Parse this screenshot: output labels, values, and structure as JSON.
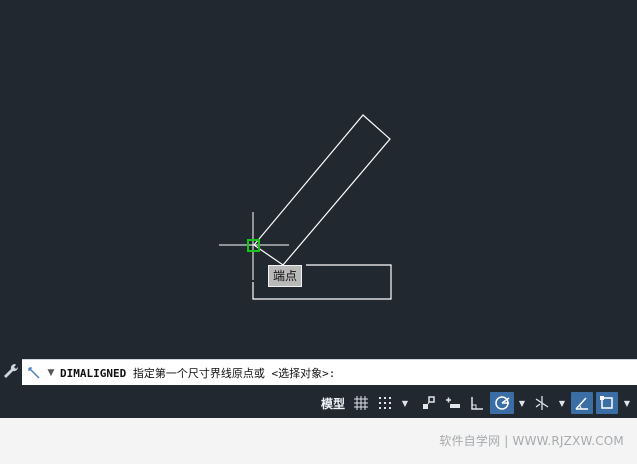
{
  "drawing": {
    "tooltip": "端点"
  },
  "command_line": {
    "command": "DIMALIGNED",
    "prompt": " 指定第一个尺寸界线原点或 <选择对象>:"
  },
  "status_bar": {
    "model_label": "模型"
  },
  "colors": {
    "canvas_bg": "#212830",
    "geometry": "#ffffff",
    "snap_marker": "#19c419",
    "active_button": "#3b6ea5"
  },
  "footer": {
    "watermark": "软件自学网 | WWW.RJZXW.COM"
  }
}
